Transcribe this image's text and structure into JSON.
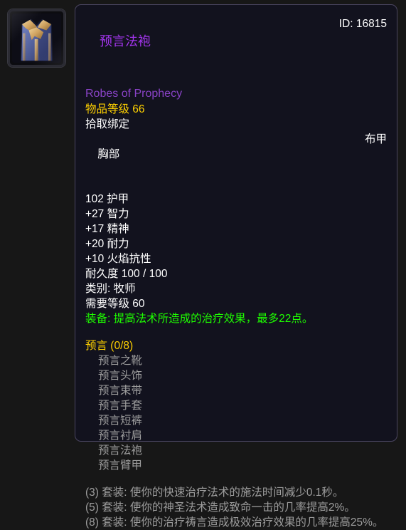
{
  "colors": {
    "page_background": "#171717",
    "tooltip_background": "#12121e",
    "tooltip_border": "#4a4560",
    "quality_epic": "#a335ee",
    "quality_epic_subtitle": "#8a43c8",
    "item_level": "#ffd100",
    "stat_white": "#ffffff",
    "equip_green": "#1eff00",
    "set_header_gold": "#ffd100",
    "set_piece_grey": "#9d9d9d",
    "set_bonus_grey": "#9d9d9d"
  },
  "icon": {
    "name": "robes-of-prophecy-icon",
    "description": "blue cloth robe with gold trim",
    "cloth_color": "#5a6bb5",
    "cloth_shadow": "#2f3a6e",
    "trim_color": "#d8ab63",
    "trim_shadow": "#8f6a33"
  },
  "tooltip": {
    "title": "预言法袍",
    "subtitle": "Robes of Prophecy",
    "item_id": "ID: 16815",
    "item_level": "物品等级 66",
    "bind": "拾取绑定",
    "slot": "胸部",
    "armor_type": "布甲",
    "armor": "102 护甲",
    "stats": [
      "+27 智力",
      "+17 精神",
      "+20 耐力",
      "+10 火焰抗性"
    ],
    "durability": "耐久度 100 / 100",
    "class_requirement": "类别: 牧师",
    "level_requirement": "需要等级 60",
    "equip_effect": "装备: 提高法术所造成的治疗效果，最多22点。",
    "set": {
      "header": "预言 (0/8)",
      "pieces": [
        "预言之靴",
        "预言头饰",
        "预言束带",
        "预言手套",
        "预言短裤",
        "预言衬肩",
        "预言法袍",
        "预言臂甲"
      ],
      "bonuses": [
        "(3) 套装: 使你的快速治疗法术的施法时间减少0.1秒。",
        "(5) 套装: 使你的神圣法术造成致命一击的几率提高2%。",
        "(8) 套装: 使你的治疗祷言造成极效治疗效果的几率提高25%。"
      ]
    }
  }
}
